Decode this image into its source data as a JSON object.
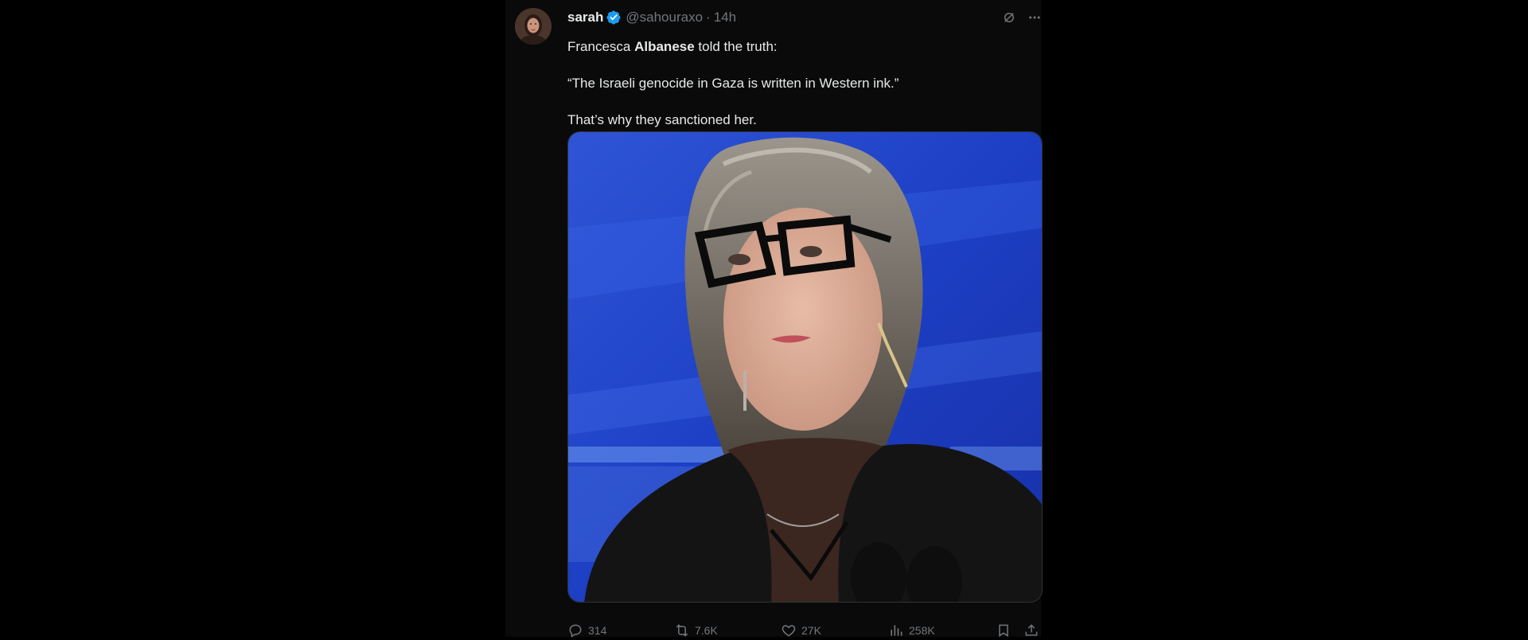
{
  "tweet": {
    "author": {
      "name": "sarah",
      "handle": "@sahouraxo",
      "verified": true
    },
    "separator": "·",
    "time": "14h",
    "text_line1_pre": "Francesca ",
    "text_line1_bold": "Albanese",
    "text_line1_post": " told the truth:",
    "text_line2": "“The Israeli genocide in Gaza is written in Western ink.”",
    "text_line3": "That’s why they sanctioned her.",
    "stats": {
      "replies": "314",
      "reposts": "7.6K",
      "likes": "27K",
      "views": "258K"
    }
  },
  "icons": {
    "verified": "verified-badge-icon",
    "grok": "grok-icon",
    "more": "more-icon",
    "reply": "reply-icon",
    "repost": "repost-icon",
    "like": "heart-icon",
    "views": "views-icon",
    "bookmark": "bookmark-icon",
    "share": "share-icon"
  },
  "colors": {
    "background": "#000000",
    "column": "#0a0a0a",
    "text": "#e7e9ea",
    "secondary": "#71767b",
    "verified": "#1d9bf0"
  }
}
